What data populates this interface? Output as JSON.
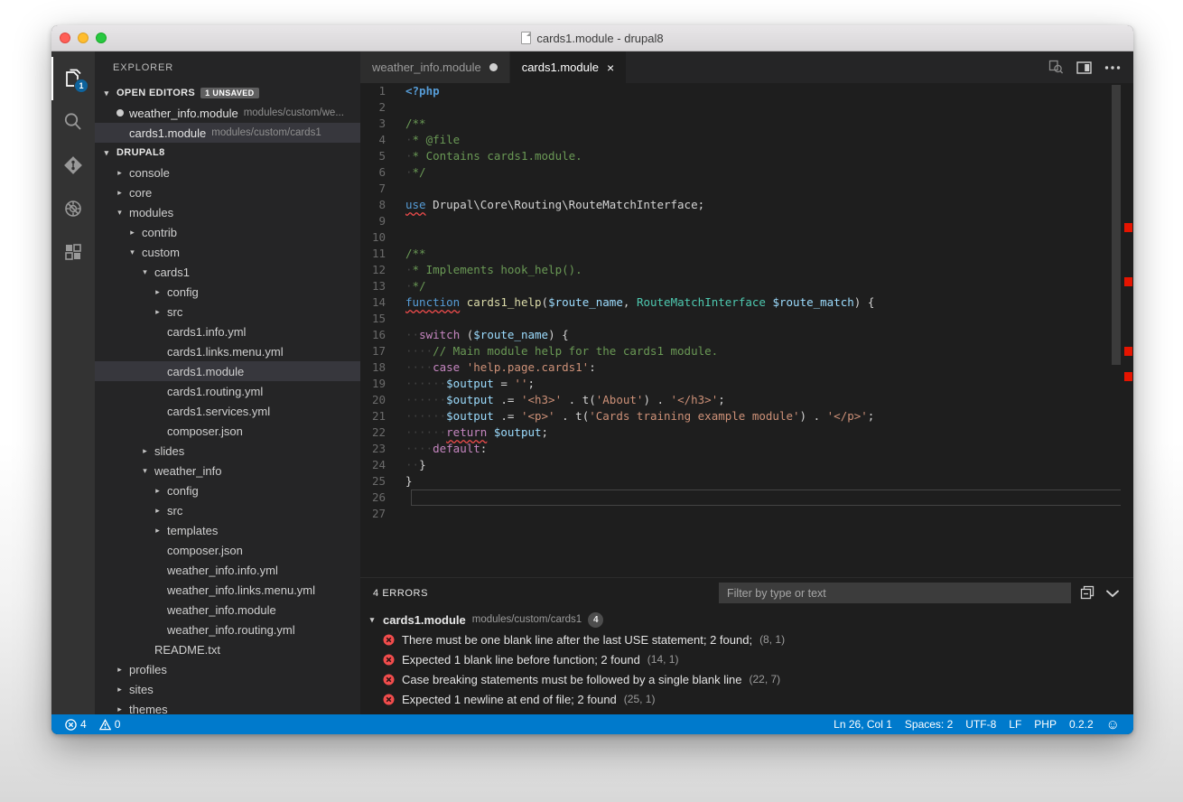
{
  "window": {
    "title": "cards1.module - drupal8",
    "traffic_lights": [
      "close",
      "minimize",
      "zoom"
    ]
  },
  "activitybar": {
    "items": [
      {
        "name": "explorer",
        "icon": "files-icon",
        "badge": "1",
        "active": true
      },
      {
        "name": "search",
        "icon": "search-icon",
        "badge": "",
        "active": false
      },
      {
        "name": "source-control",
        "icon": "source-control-icon",
        "badge": "",
        "active": false
      },
      {
        "name": "debug",
        "icon": "debug-icon",
        "badge": "",
        "active": false
      },
      {
        "name": "extensions",
        "icon": "extensions-icon",
        "badge": "",
        "active": false
      }
    ]
  },
  "sidebar": {
    "title": "EXPLORER",
    "open_editors": {
      "label": "OPEN EDITORS",
      "badge": "1 UNSAVED",
      "items": [
        {
          "name": "weather_info.module",
          "path": "modules/custom/we...",
          "dirty": true,
          "selected": false
        },
        {
          "name": "cards1.module",
          "path": "modules/custom/cards1",
          "dirty": false,
          "selected": true
        }
      ]
    },
    "folder": {
      "label": "DRUPAL8",
      "tree": [
        {
          "label": "console",
          "depth": 1,
          "kind": "folder",
          "expanded": false,
          "selected": false
        },
        {
          "label": "core",
          "depth": 1,
          "kind": "folder",
          "expanded": false,
          "selected": false
        },
        {
          "label": "modules",
          "depth": 1,
          "kind": "folder",
          "expanded": true,
          "selected": false
        },
        {
          "label": "contrib",
          "depth": 2,
          "kind": "folder",
          "expanded": false,
          "selected": false
        },
        {
          "label": "custom",
          "depth": 2,
          "kind": "folder",
          "expanded": true,
          "selected": false
        },
        {
          "label": "cards1",
          "depth": 3,
          "kind": "folder",
          "expanded": true,
          "selected": false
        },
        {
          "label": "config",
          "depth": 4,
          "kind": "folder",
          "expanded": false,
          "selected": false
        },
        {
          "label": "src",
          "depth": 4,
          "kind": "folder",
          "expanded": false,
          "selected": false
        },
        {
          "label": "cards1.info.yml",
          "depth": 4,
          "kind": "file",
          "expanded": false,
          "selected": false
        },
        {
          "label": "cards1.links.menu.yml",
          "depth": 4,
          "kind": "file",
          "expanded": false,
          "selected": false
        },
        {
          "label": "cards1.module",
          "depth": 4,
          "kind": "file",
          "expanded": false,
          "selected": true
        },
        {
          "label": "cards1.routing.yml",
          "depth": 4,
          "kind": "file",
          "expanded": false,
          "selected": false
        },
        {
          "label": "cards1.services.yml",
          "depth": 4,
          "kind": "file",
          "expanded": false,
          "selected": false
        },
        {
          "label": "composer.json",
          "depth": 4,
          "kind": "file",
          "expanded": false,
          "selected": false
        },
        {
          "label": "slides",
          "depth": 3,
          "kind": "folder",
          "expanded": false,
          "selected": false
        },
        {
          "label": "weather_info",
          "depth": 3,
          "kind": "folder",
          "expanded": true,
          "selected": false
        },
        {
          "label": "config",
          "depth": 4,
          "kind": "folder",
          "expanded": false,
          "selected": false
        },
        {
          "label": "src",
          "depth": 4,
          "kind": "folder",
          "expanded": false,
          "selected": false
        },
        {
          "label": "templates",
          "depth": 4,
          "kind": "folder",
          "expanded": false,
          "selected": false
        },
        {
          "label": "composer.json",
          "depth": 4,
          "kind": "file",
          "expanded": false,
          "selected": false
        },
        {
          "label": "weather_info.info.yml",
          "depth": 4,
          "kind": "file",
          "expanded": false,
          "selected": false
        },
        {
          "label": "weather_info.links.menu.yml",
          "depth": 4,
          "kind": "file",
          "expanded": false,
          "selected": false
        },
        {
          "label": "weather_info.module",
          "depth": 4,
          "kind": "file",
          "expanded": false,
          "selected": false
        },
        {
          "label": "weather_info.routing.yml",
          "depth": 4,
          "kind": "file",
          "expanded": false,
          "selected": false
        },
        {
          "label": "README.txt",
          "depth": 3,
          "kind": "file",
          "expanded": false,
          "selected": false
        },
        {
          "label": "profiles",
          "depth": 1,
          "kind": "folder",
          "expanded": false,
          "selected": false
        },
        {
          "label": "sites",
          "depth": 1,
          "kind": "folder",
          "expanded": false,
          "selected": false
        },
        {
          "label": "themes",
          "depth": 1,
          "kind": "folder",
          "expanded": false,
          "selected": false
        }
      ]
    }
  },
  "editor": {
    "tabs": [
      {
        "label": "weather_info.module",
        "active": false,
        "dirty": true,
        "close_label": ""
      },
      {
        "label": "cards1.module",
        "active": true,
        "dirty": false,
        "close_label": "×"
      }
    ],
    "actions": [
      "open-changes-icon",
      "split-editor-icon",
      "more-actions-icon"
    ],
    "current_line": 26,
    "lines": [
      {
        "no": "1",
        "tokens": [
          {
            "t": "<?php",
            "c": "t-php"
          }
        ]
      },
      {
        "no": "2",
        "tokens": []
      },
      {
        "no": "3",
        "tokens": [
          {
            "t": "/**",
            "c": "t-com"
          }
        ]
      },
      {
        "no": "4",
        "tokens": [
          {
            "t": "·",
            "c": "t-ws"
          },
          {
            "t": "* @file",
            "c": "t-com"
          }
        ]
      },
      {
        "no": "5",
        "tokens": [
          {
            "t": "·",
            "c": "t-ws"
          },
          {
            "t": "* Contains cards1.module.",
            "c": "t-com"
          }
        ]
      },
      {
        "no": "6",
        "tokens": [
          {
            "t": "·",
            "c": "t-ws"
          },
          {
            "t": "*/",
            "c": "t-com"
          }
        ]
      },
      {
        "no": "7",
        "tokens": []
      },
      {
        "no": "8",
        "tokens": [
          {
            "t": "use",
            "c": "t-kw squiggle"
          },
          {
            "t": " ",
            "c": "t-pl"
          },
          {
            "t": "Drupal\\Core\\Routing\\RouteMatchInterface",
            "c": "t-pl"
          },
          {
            "t": ";",
            "c": "t-pl"
          }
        ]
      },
      {
        "no": "9",
        "tokens": []
      },
      {
        "no": "10",
        "tokens": []
      },
      {
        "no": "11",
        "tokens": [
          {
            "t": "/**",
            "c": "t-com"
          }
        ]
      },
      {
        "no": "12",
        "tokens": [
          {
            "t": "·",
            "c": "t-ws"
          },
          {
            "t": "* Implements hook_help().",
            "c": "t-com"
          }
        ]
      },
      {
        "no": "13",
        "tokens": [
          {
            "t": "·",
            "c": "t-ws"
          },
          {
            "t": "*/",
            "c": "t-com"
          }
        ]
      },
      {
        "no": "14",
        "tokens": [
          {
            "t": "function",
            "c": "t-kw squiggle"
          },
          {
            "t": " ",
            "c": "t-pl"
          },
          {
            "t": "cards1_help",
            "c": "t-fn"
          },
          {
            "t": "(",
            "c": "t-pl"
          },
          {
            "t": "$route_name",
            "c": "t-var"
          },
          {
            "t": ", ",
            "c": "t-pl"
          },
          {
            "t": "RouteMatchInterface",
            "c": "t-type"
          },
          {
            "t": " ",
            "c": "t-pl"
          },
          {
            "t": "$route_match",
            "c": "t-var"
          },
          {
            "t": ") {",
            "c": "t-pl"
          }
        ]
      },
      {
        "no": "15",
        "tokens": []
      },
      {
        "no": "16",
        "tokens": [
          {
            "t": "··",
            "c": "t-ws"
          },
          {
            "t": "switch",
            "c": "t-kw2"
          },
          {
            "t": " (",
            "c": "t-pl"
          },
          {
            "t": "$route_name",
            "c": "t-var"
          },
          {
            "t": ") {",
            "c": "t-pl"
          }
        ]
      },
      {
        "no": "17",
        "tokens": [
          {
            "t": "····",
            "c": "t-ws"
          },
          {
            "t": "// Main module help for the cards1 module.",
            "c": "t-com"
          }
        ]
      },
      {
        "no": "18",
        "tokens": [
          {
            "t": "····",
            "c": "t-ws"
          },
          {
            "t": "case",
            "c": "t-kw2"
          },
          {
            "t": " ",
            "c": "t-pl"
          },
          {
            "t": "'help.page.cards1'",
            "c": "t-str"
          },
          {
            "t": ":",
            "c": "t-pl"
          }
        ]
      },
      {
        "no": "19",
        "tokens": [
          {
            "t": "······",
            "c": "t-ws"
          },
          {
            "t": "$output",
            "c": "t-var"
          },
          {
            "t": " = ",
            "c": "t-pl"
          },
          {
            "t": "''",
            "c": "t-str"
          },
          {
            "t": ";",
            "c": "t-pl"
          }
        ]
      },
      {
        "no": "20",
        "tokens": [
          {
            "t": "······",
            "c": "t-ws"
          },
          {
            "t": "$output",
            "c": "t-var"
          },
          {
            "t": " .= ",
            "c": "t-pl"
          },
          {
            "t": "'<h3>'",
            "c": "t-str"
          },
          {
            "t": " . ",
            "c": "t-pl"
          },
          {
            "t": "t(",
            "c": "t-pl"
          },
          {
            "t": "'About'",
            "c": "t-str"
          },
          {
            "t": ")",
            "c": "t-pl"
          },
          {
            "t": " . ",
            "c": "t-pl"
          },
          {
            "t": "'</h3>'",
            "c": "t-str"
          },
          {
            "t": ";",
            "c": "t-pl"
          }
        ]
      },
      {
        "no": "21",
        "tokens": [
          {
            "t": "······",
            "c": "t-ws"
          },
          {
            "t": "$output",
            "c": "t-var"
          },
          {
            "t": " .= ",
            "c": "t-pl"
          },
          {
            "t": "'<p>'",
            "c": "t-str"
          },
          {
            "t": " . ",
            "c": "t-pl"
          },
          {
            "t": "t(",
            "c": "t-pl"
          },
          {
            "t": "'Cards training example module'",
            "c": "t-str"
          },
          {
            "t": ")",
            "c": "t-pl"
          },
          {
            "t": " . ",
            "c": "t-pl"
          },
          {
            "t": "'</p>'",
            "c": "t-str"
          },
          {
            "t": ";",
            "c": "t-pl"
          }
        ]
      },
      {
        "no": "22",
        "tokens": [
          {
            "t": "······",
            "c": "t-ws"
          },
          {
            "t": "return",
            "c": "t-kw2 squiggle"
          },
          {
            "t": " ",
            "c": "t-pl"
          },
          {
            "t": "$output",
            "c": "t-var"
          },
          {
            "t": ";",
            "c": "t-pl"
          }
        ]
      },
      {
        "no": "23",
        "tokens": [
          {
            "t": "····",
            "c": "t-ws"
          },
          {
            "t": "default",
            "c": "t-kw2"
          },
          {
            "t": ":",
            "c": "t-pl"
          }
        ]
      },
      {
        "no": "24",
        "tokens": [
          {
            "t": "··",
            "c": "t-ws"
          },
          {
            "t": "}",
            "c": "t-pl"
          }
        ]
      },
      {
        "no": "25",
        "tokens": [
          {
            "t": "}",
            "c": "t-pl"
          }
        ]
      },
      {
        "no": "26",
        "tokens": []
      },
      {
        "no": "27",
        "tokens": []
      }
    ],
    "ruler_marks": [
      155,
      215,
      292,
      320
    ]
  },
  "panel": {
    "title": "4 ERRORS",
    "filter_placeholder": "Filter by type or text",
    "actions": [
      "collapse-all-icon",
      "close-panel-icon"
    ],
    "file_group": {
      "name": "cards1.module",
      "path": "modules/custom/cards1",
      "count": "4"
    },
    "problems": [
      {
        "message": "There must be one blank line after the last USE statement; 2 found;",
        "position": "(8, 1)",
        "severity": "error"
      },
      {
        "message": "Expected 1 blank line before function; 2 found",
        "position": "(14, 1)",
        "severity": "error"
      },
      {
        "message": "Case breaking statements must be followed by a single blank line",
        "position": "(22, 7)",
        "severity": "error"
      },
      {
        "message": "Expected 1 newline at end of file; 2 found",
        "position": "(25, 1)",
        "severity": "error"
      }
    ]
  },
  "statusbar": {
    "background": "#007acc",
    "left": [
      {
        "icon": "error-icon",
        "label": "4"
      },
      {
        "icon": "warning-icon",
        "label": "0"
      }
    ],
    "right": [
      {
        "name": "cursor-position",
        "label": "Ln 26, Col 1"
      },
      {
        "name": "indentation",
        "label": "Spaces: 2"
      },
      {
        "name": "encoding",
        "label": "UTF-8"
      },
      {
        "name": "eol",
        "label": "LF"
      },
      {
        "name": "language-mode",
        "label": "PHP"
      },
      {
        "name": "version",
        "label": "0.2.2"
      },
      {
        "name": "feedback-smiley",
        "label": "☺"
      }
    ]
  }
}
